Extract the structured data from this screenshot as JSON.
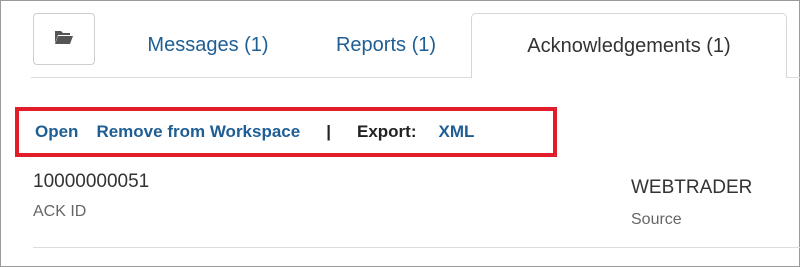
{
  "tabs": {
    "folder_icon": "folder-open-icon",
    "items": [
      {
        "label": "Messages (1)"
      },
      {
        "label": "Reports (1)"
      },
      {
        "label": "Acknowledgements (1)"
      }
    ],
    "active_index": 2
  },
  "toolbar": {
    "open_label": "Open",
    "remove_label": "Remove from Workspace",
    "separator": "|",
    "export_label": "Export:",
    "xml_label": "XML",
    "highlight_color": "#e11d2a"
  },
  "record": {
    "ack_id_value": "10000000051",
    "ack_id_label": "ACK ID",
    "source_value": "WEBTRADER",
    "source_label": "Source"
  },
  "colors": {
    "link": "#1f5e94",
    "text": "#333333",
    "muted": "#666666"
  }
}
